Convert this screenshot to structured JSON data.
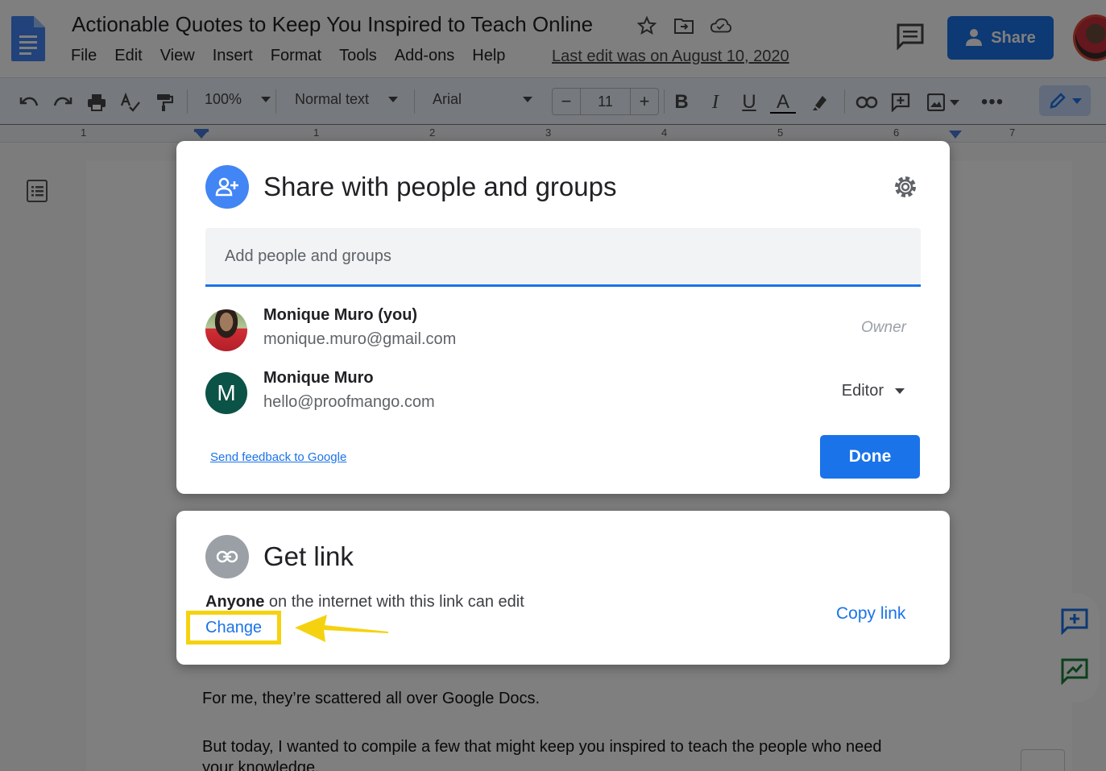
{
  "header": {
    "doc_title": "Actionable Quotes to Keep You Inspired to Teach Online",
    "menu": [
      "File",
      "Edit",
      "View",
      "Insert",
      "Format",
      "Tools",
      "Add-ons",
      "Help"
    ],
    "last_edit": "Last edit was on August 10, 2020",
    "share_label": "Share"
  },
  "toolbar": {
    "zoom": "100%",
    "style": "Normal text",
    "font": "Arial",
    "font_size": "11",
    "minus": "−",
    "plus": "+"
  },
  "ruler": {
    "numbers": [
      "1",
      "1",
      "2",
      "3",
      "4",
      "5",
      "6",
      "7"
    ]
  },
  "document": {
    "line1": "For me, they’re scattered all over Google Docs.",
    "line2": "But today, I wanted to compile a few that might keep you inspired to teach the people who need",
    "line3": "your knowledge."
  },
  "share_dialog": {
    "title": "Share with people and groups",
    "input_placeholder": "Add people and groups",
    "people": [
      {
        "name": "Monique Muro (you)",
        "email": "monique.muro@gmail.com",
        "role": "Owner"
      },
      {
        "name": "Monique Muro",
        "email": "hello@proofmango.com",
        "role": "Editor",
        "initial": "M"
      }
    ],
    "feedback_link": "Send feedback to Google",
    "done_label": "Done"
  },
  "link_dialog": {
    "title": "Get link",
    "desc_strong": "Anyone",
    "desc_rest": " on the internet with this link can edit",
    "change_label": "Change",
    "copy_label": "Copy link"
  },
  "colors": {
    "accent": "#1a73e8",
    "highlight": "#f5d20f",
    "editor_avatar": "#0b5346"
  }
}
